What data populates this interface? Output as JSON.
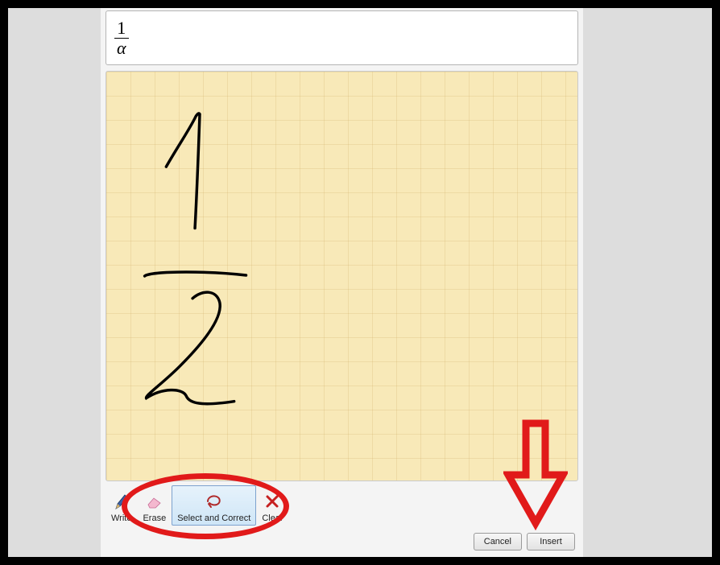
{
  "preview": {
    "numerator": "1",
    "denominator": "α"
  },
  "toolbar": {
    "write": {
      "label": "Write",
      "icon": "pencil-icon"
    },
    "erase": {
      "label": "Erase",
      "icon": "eraser-icon"
    },
    "select_correct": {
      "label": "Select and Correct",
      "icon": "lasso-icon"
    },
    "clear": {
      "label": "Clear",
      "icon": "x-icon"
    }
  },
  "buttons": {
    "cancel": "Cancel",
    "insert": "Insert"
  },
  "annotation": {
    "highlight_target": "select-and-correct",
    "arrow_target": "insert-button"
  }
}
